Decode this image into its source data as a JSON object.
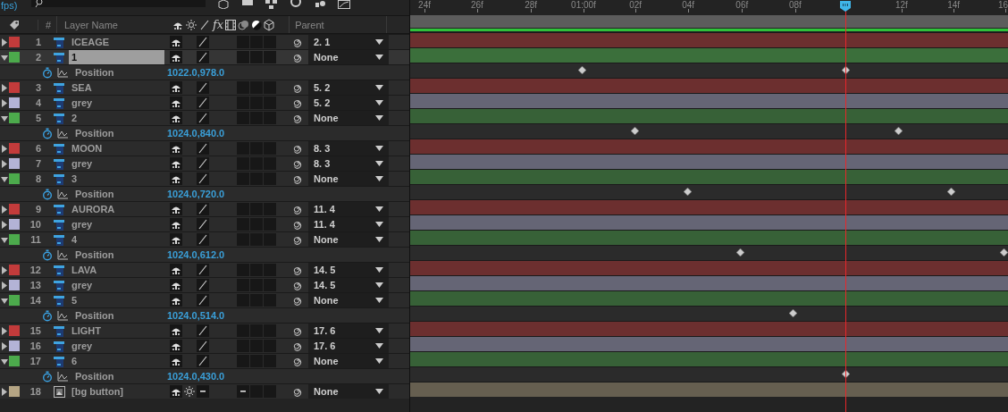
{
  "top_bar": {
    "fps_label": "fps)"
  },
  "header": {
    "number": "#",
    "layer_name": "Layer Name",
    "fx": "fx",
    "parent": "Parent"
  },
  "ruler": {
    "ticks": [
      {
        "label": "24f",
        "level": 0.024
      },
      {
        "label": "26f",
        "level": 0.112
      },
      {
        "label": "28f",
        "level": 0.202
      },
      {
        "label": "01:00f",
        "level": 0.29
      },
      {
        "label": "02f",
        "level": 0.377
      },
      {
        "label": "04f",
        "level": 0.465
      },
      {
        "label": "06f",
        "level": 0.555
      },
      {
        "label": "08f",
        "level": 0.644
      },
      {
        "label": "12f",
        "level": 0.822
      },
      {
        "label": "14f",
        "level": 0.909
      },
      {
        "label": "16",
        "level": 0.996
      }
    ],
    "time_indicator": {
      "level": 0.728
    }
  },
  "layers": [
    {
      "number": "1",
      "name": "ICEAGE",
      "kind": "precomp",
      "color": "#c23b3b",
      "expanded": false,
      "selected": false,
      "parent": "2. 1"
    },
    {
      "number": "2",
      "name": "1",
      "kind": "precomp",
      "color": "#4caa4c",
      "expanded": true,
      "selected": true,
      "parent": "None",
      "property": {
        "name": "Position",
        "value": "1022.0,978.0",
        "keyframes": [
          {
            "level": 0.287
          },
          {
            "level": 0.728
          }
        ]
      }
    },
    {
      "number": "3",
      "name": "SEA",
      "kind": "precomp",
      "color": "#c23b3b",
      "expanded": false,
      "selected": false,
      "parent": "5. 2"
    },
    {
      "number": "4",
      "name": "grey",
      "kind": "precomp",
      "color": "#b3b3d6",
      "expanded": false,
      "selected": false,
      "parent": "5. 2"
    },
    {
      "number": "5",
      "name": "2",
      "kind": "precomp",
      "color": "#4caa4c",
      "expanded": true,
      "selected": false,
      "parent": "None",
      "property": {
        "name": "Position",
        "value": "1024.0,840.0",
        "keyframes": [
          {
            "level": 0.375
          },
          {
            "level": 0.816
          }
        ]
      }
    },
    {
      "number": "6",
      "name": "MOON",
      "kind": "precomp",
      "color": "#c23b3b",
      "expanded": false,
      "selected": false,
      "parent": "8. 3"
    },
    {
      "number": "7",
      "name": "grey",
      "kind": "precomp",
      "color": "#b3b3d6",
      "expanded": false,
      "selected": false,
      "parent": "8. 3"
    },
    {
      "number": "8",
      "name": "3",
      "kind": "precomp",
      "color": "#4caa4c",
      "expanded": true,
      "selected": false,
      "parent": "None",
      "property": {
        "name": "Position",
        "value": "1024.0,720.0",
        "keyframes": [
          {
            "level": 0.463
          },
          {
            "level": 0.904
          }
        ]
      }
    },
    {
      "number": "9",
      "name": "AURORA",
      "kind": "precomp",
      "color": "#c23b3b",
      "expanded": false,
      "selected": false,
      "parent": "11. 4"
    },
    {
      "number": "10",
      "name": "grey",
      "kind": "precomp",
      "color": "#b3b3d6",
      "expanded": false,
      "selected": false,
      "parent": "11. 4"
    },
    {
      "number": "11",
      "name": "4",
      "kind": "precomp",
      "color": "#4caa4c",
      "expanded": true,
      "selected": false,
      "parent": "None",
      "property": {
        "name": "Position",
        "value": "1024.0,612.0",
        "keyframes": [
          {
            "level": 0.551
          },
          {
            "level": 0.993
          }
        ]
      }
    },
    {
      "number": "12",
      "name": "LAVA",
      "kind": "precomp",
      "color": "#c23b3b",
      "expanded": false,
      "selected": false,
      "parent": "14. 5"
    },
    {
      "number": "13",
      "name": "grey",
      "kind": "precomp",
      "color": "#b3b3d6",
      "expanded": false,
      "selected": false,
      "parent": "14. 5"
    },
    {
      "number": "14",
      "name": "5",
      "kind": "precomp",
      "color": "#4caa4c",
      "expanded": true,
      "selected": false,
      "parent": "None",
      "property": {
        "name": "Position",
        "value": "1024.0,514.0",
        "keyframes": [
          {
            "level": 0.64
          }
        ]
      }
    },
    {
      "number": "15",
      "name": "LIGHT",
      "kind": "precomp",
      "color": "#c23b3b",
      "expanded": false,
      "selected": false,
      "parent": "17. 6"
    },
    {
      "number": "16",
      "name": "grey",
      "kind": "precomp",
      "color": "#b3b3d6",
      "expanded": false,
      "selected": false,
      "parent": "17. 6"
    },
    {
      "number": "17",
      "name": "6",
      "kind": "precomp",
      "color": "#4caa4c",
      "expanded": true,
      "selected": false,
      "parent": "None",
      "property": {
        "name": "Position",
        "value": "1024.0,430.0",
        "keyframes": [
          {
            "level": 0.728
          }
        ]
      }
    },
    {
      "number": "18",
      "name": "[bg button]",
      "kind": "footage",
      "color": "#b5a584",
      "expanded": false,
      "selected": false,
      "parent": "None"
    }
  ]
}
